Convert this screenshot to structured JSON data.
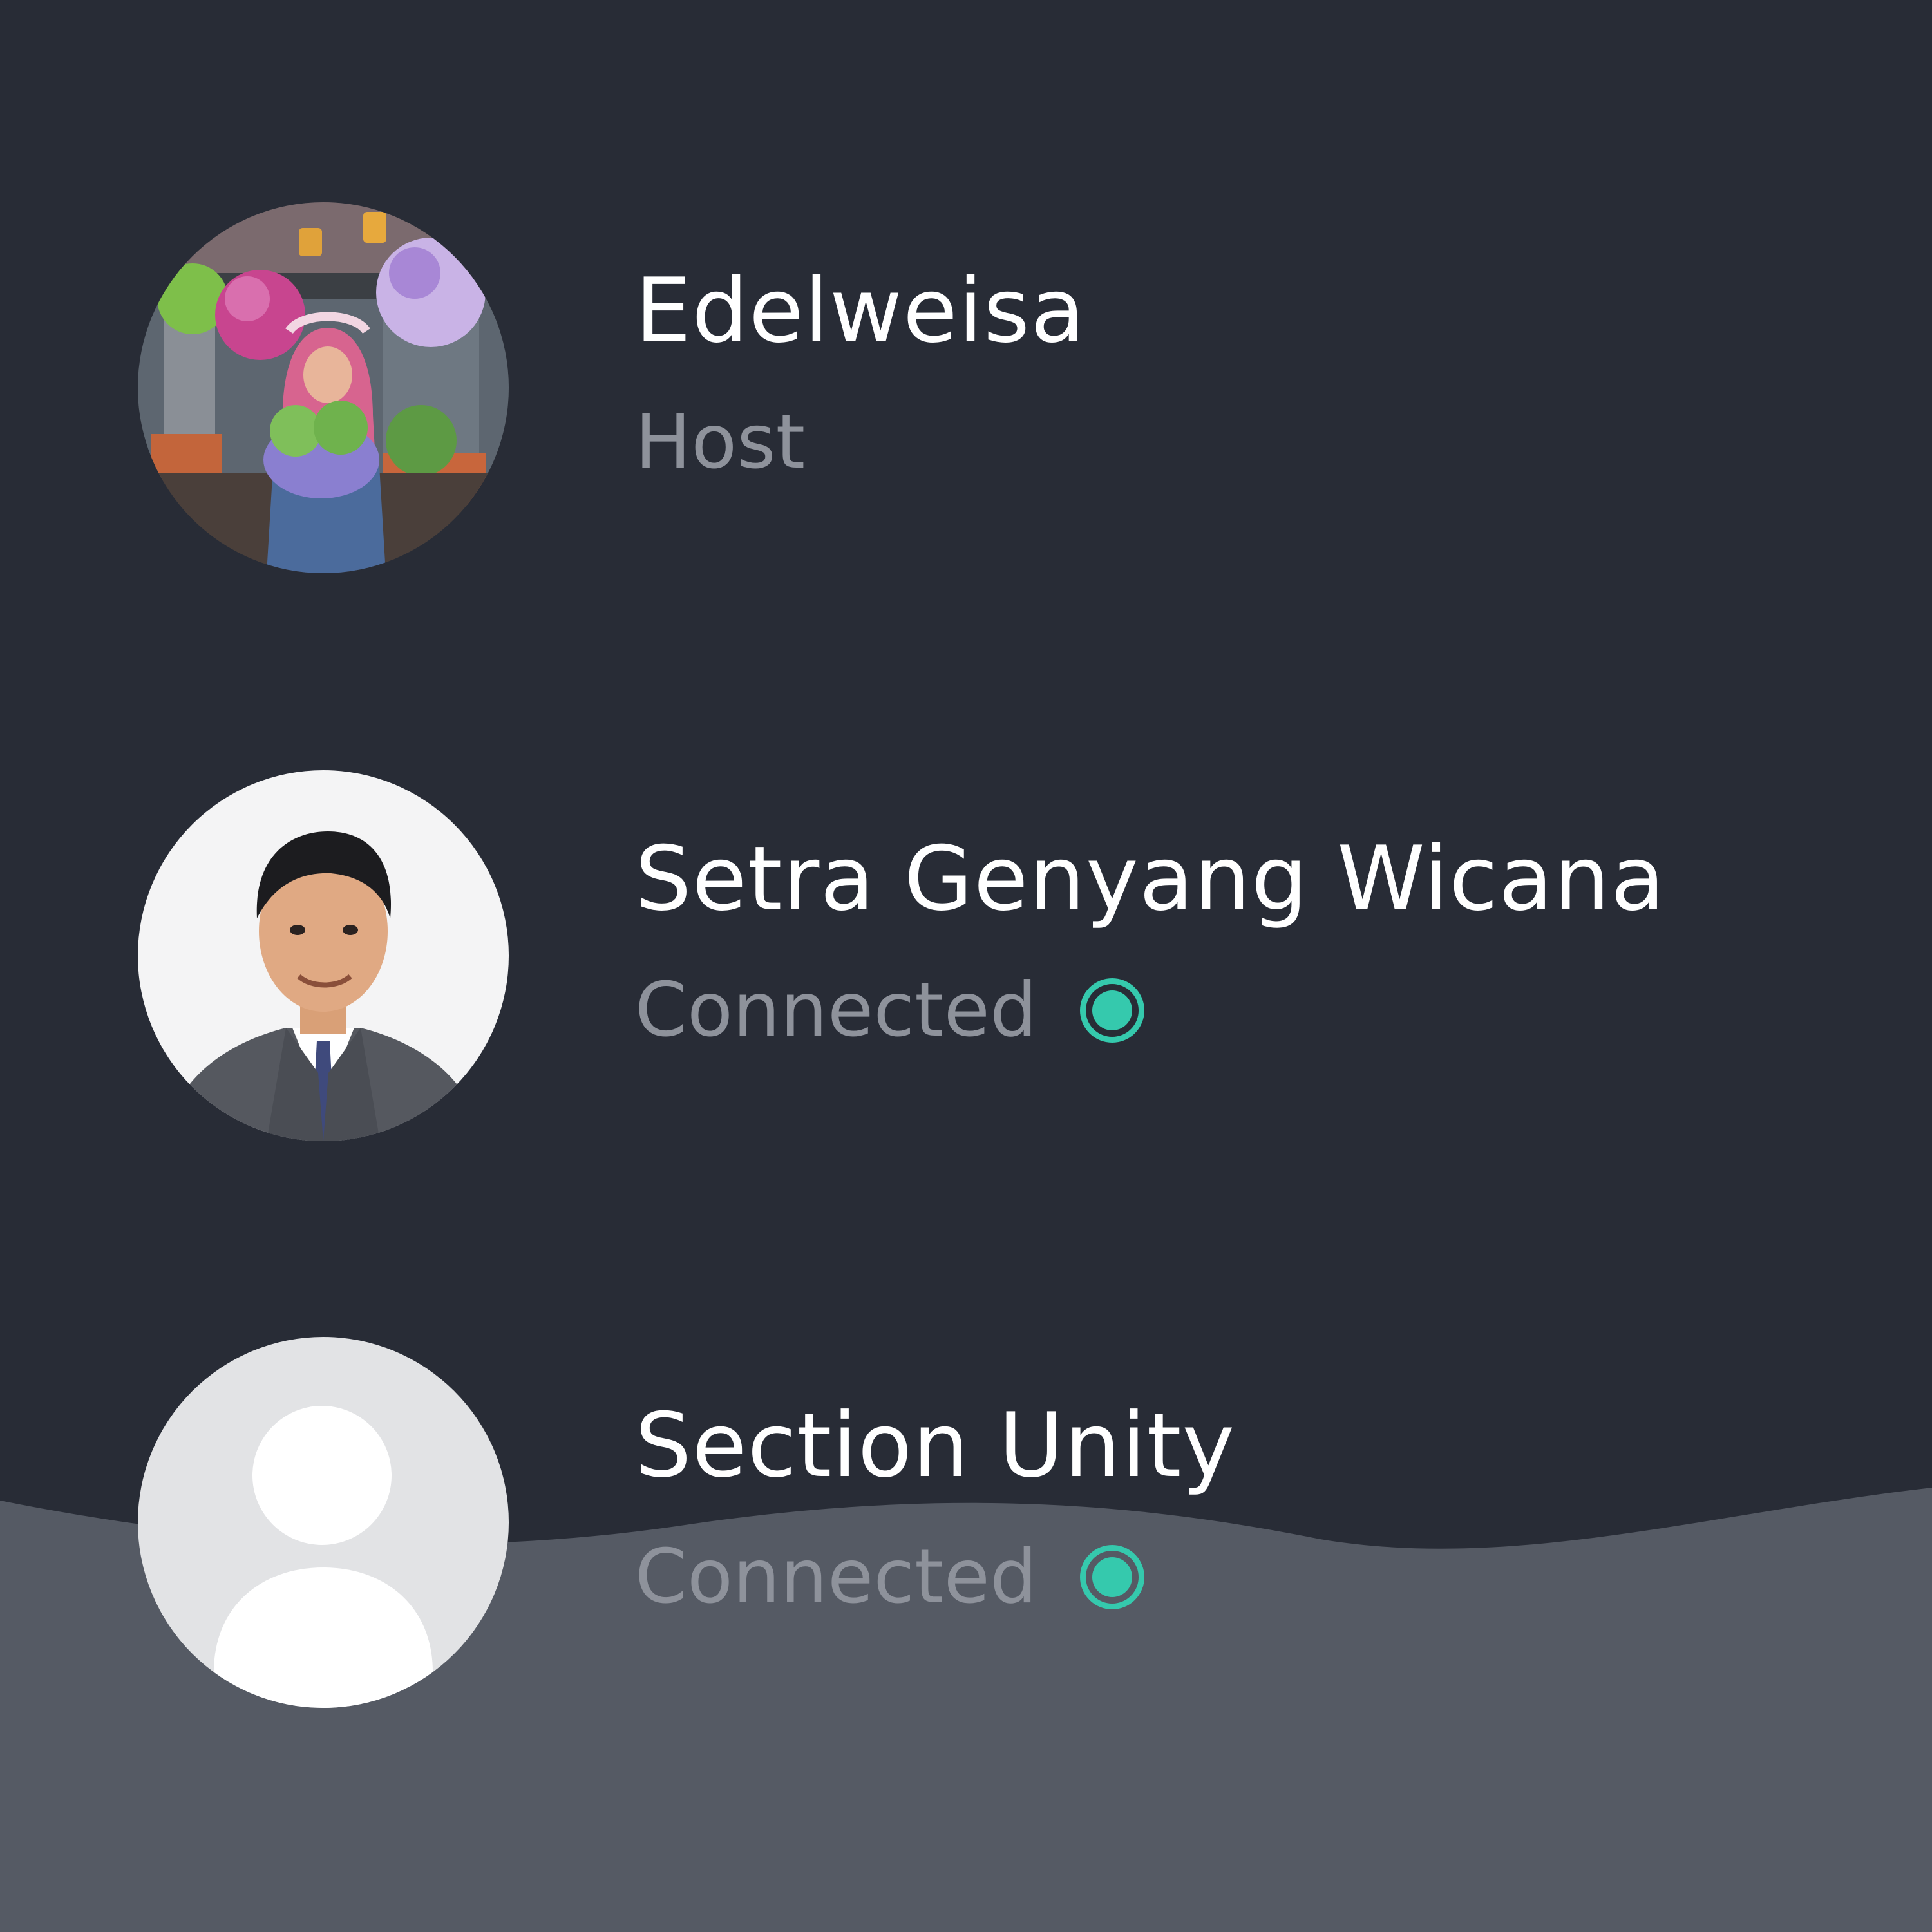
{
  "colors": {
    "background": "#282c36",
    "wave": "#555a64",
    "name_text": "#ffffff",
    "status_text": "#8e929b",
    "connected_indicator": "#35c9ad",
    "default_avatar_bg": "#e2e3e5"
  },
  "participants": [
    {
      "name": "Edelweisa",
      "status": "Host",
      "avatar": "photo-avatar",
      "connected_indicator": false
    },
    {
      "name": "Setra Genyang Wicana",
      "status": "Connected",
      "avatar": "photo-avatar",
      "connected_indicator": true
    },
    {
      "name": "Section Unity",
      "status": "Connected",
      "avatar": "default-person-icon",
      "connected_indicator": true
    }
  ]
}
